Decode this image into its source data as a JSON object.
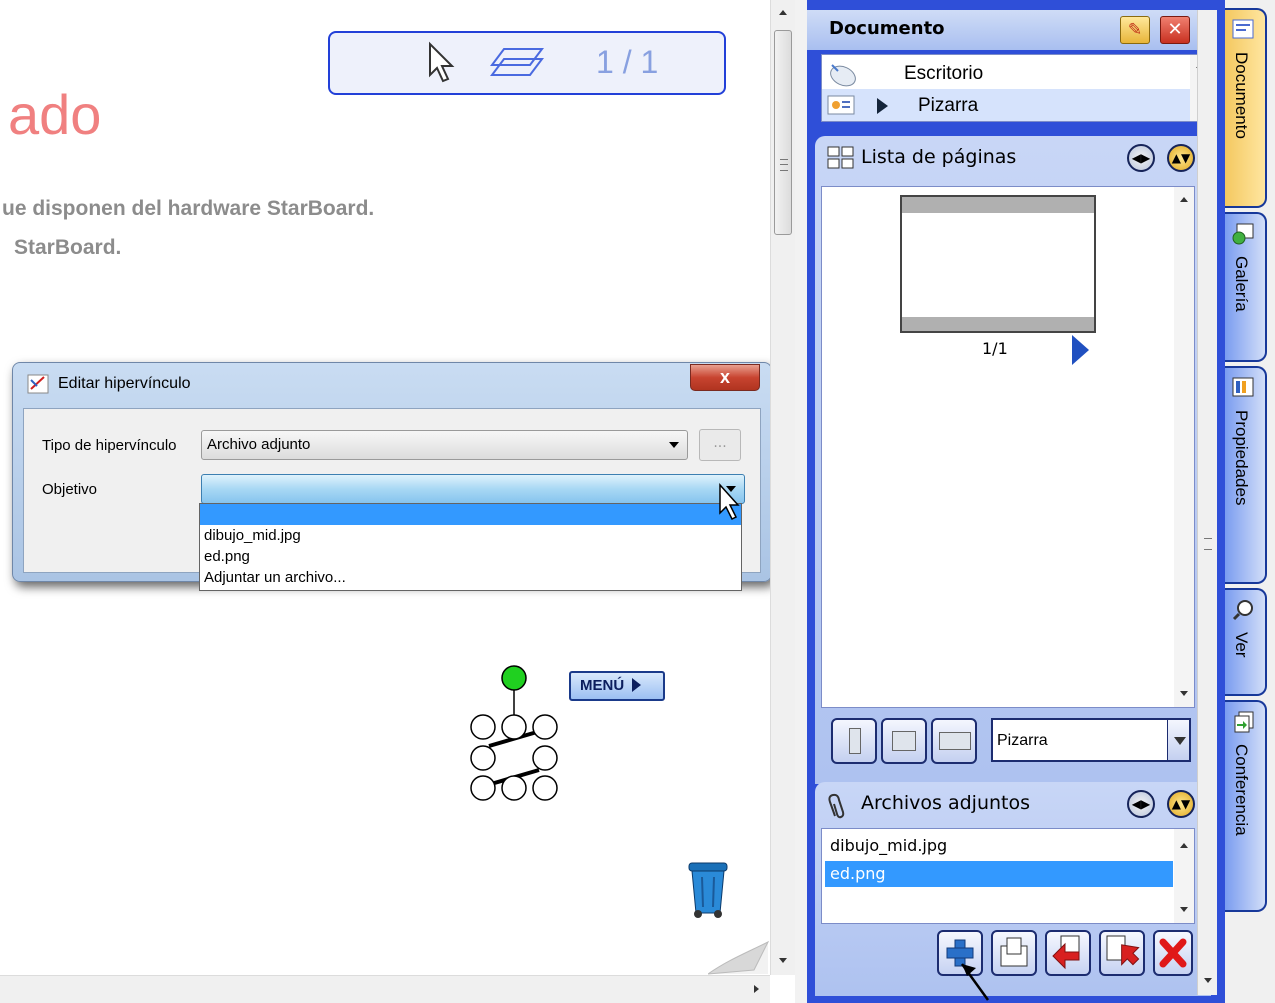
{
  "canvas": {
    "title_fragment": "ado",
    "line1": "ue disponen del hardware StarBoard.",
    "line2": "StarBoard.",
    "page_indicator": "1 / 1",
    "menu_button": "MENÚ"
  },
  "dialog": {
    "title": "Editar hipervínculo",
    "close_label": "x",
    "tipo_label": "Tipo de hipervínculo",
    "tipo_value": "Archivo adjunto",
    "browse_label": "...",
    "objetivo_label": "Objetivo",
    "objetivo_value": "",
    "options": [
      "",
      "dibujo_mid.jpg",
      "ed.png",
      "Adjuntar un archivo..."
    ]
  },
  "panel": {
    "header_title": "Documento",
    "doc_items": [
      "Escritorio",
      "Pizarra"
    ],
    "pages_title": "Lista de páginas",
    "thumb_label": "1/1",
    "view_select": "Pizarra",
    "attachments_title": "Archivos adjuntos",
    "attachments": [
      "dibujo_mid.jpg",
      "ed.png"
    ]
  },
  "tabs": [
    "Documento",
    "Galería",
    "Propiedades",
    "Ver",
    "Conferencia"
  ],
  "colors": {
    "panel_blue": "#2f4fd8",
    "selection_blue": "#3399ff",
    "title_pink": "#f08080",
    "active_tab": "#f4c860"
  }
}
